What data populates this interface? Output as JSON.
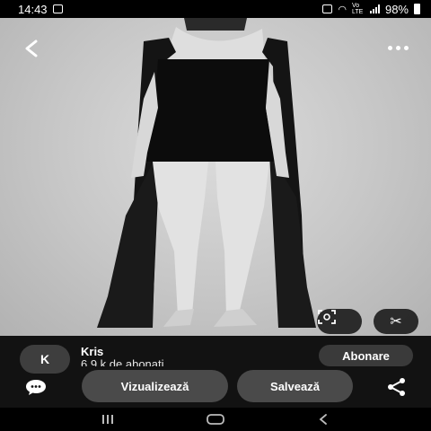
{
  "status_bar": {
    "time": "14:43",
    "battery_percent": "98%",
    "network_label": "Vo LTE"
  },
  "photo": {
    "description_icon": "fashion-photo"
  },
  "toolbar": {
    "back_icon": "chevron-left-icon",
    "more_icon": "more-horizontal-icon",
    "lens_icon": "visual-search-icon",
    "cut_icon": "scissors-icon"
  },
  "creator": {
    "avatar_letter": "K",
    "name": "Kris",
    "followers": "6,9 k de abonați",
    "follow_label": "Abonare"
  },
  "actions": {
    "view_label": "Vizualizează",
    "save_label": "Salvează",
    "comment_icon": "comment-icon",
    "share_icon": "share-icon"
  },
  "colors": {
    "panel": "#121212",
    "button": "#4a4a4a",
    "text": "#ffffff"
  }
}
